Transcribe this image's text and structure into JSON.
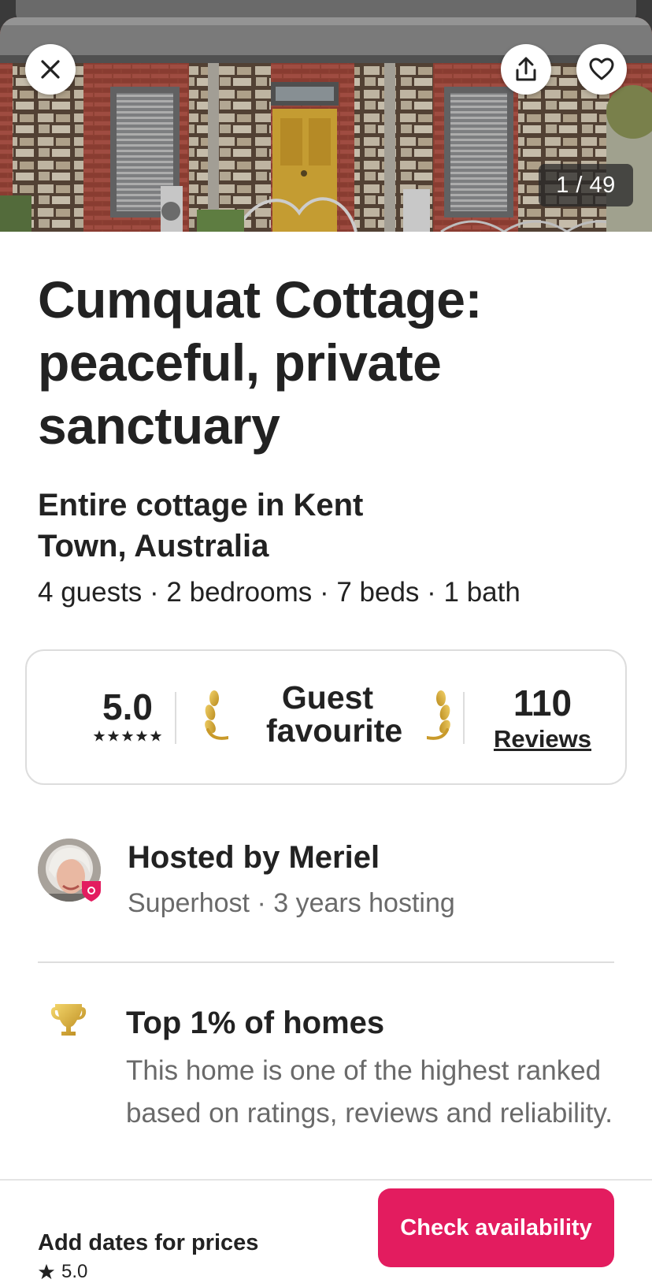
{
  "hero": {
    "photo_counter": "1 / 49",
    "photo_alt": "Stone cottage with yellow front door"
  },
  "listing": {
    "title": "Cumquat Cottage: peaceful, private sanctuary",
    "subtitle": "Entire cottage in Kent Town, Australia",
    "details": "4 guests · 2 bedrooms · 7 beds · 1 bath"
  },
  "rating_card": {
    "score": "5.0",
    "stars": 5,
    "badge": "Guest favourite",
    "reviews_count": "110",
    "reviews_label": "Reviews"
  },
  "host": {
    "name": "Hosted by Meriel",
    "meta": "Superhost · 3 years hosting"
  },
  "highlight": {
    "title": "Top 1% of homes",
    "description": "This home is one of the highest ranked based on ratings, reviews and reliability."
  },
  "footer": {
    "price_label": "Add dates for prices",
    "rating": "5.0",
    "cta_label": "Check availability"
  },
  "colors": {
    "brand": "#e31c5f",
    "text": "#222222",
    "muted": "#6a6a6a"
  },
  "icons": {
    "close": "close-icon",
    "share": "share-icon",
    "favorite": "heart-icon",
    "trophy": "trophy-icon",
    "star": "star-icon",
    "laurel": "laurel-icon"
  }
}
